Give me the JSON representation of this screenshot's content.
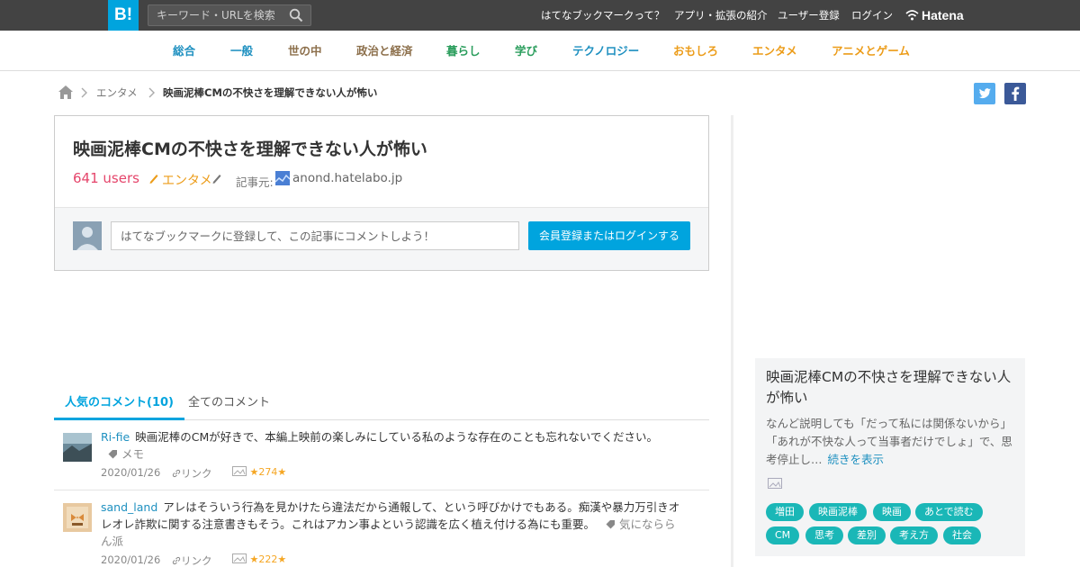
{
  "header": {
    "logo": "B!",
    "search_placeholder": "キーワード・URLを検索",
    "nav": [
      "はてなブックマークって？",
      "アプリ・拡張の紹介",
      "ユーザー登録",
      "ログイン"
    ],
    "brand": "Hatena"
  },
  "categories": [
    {
      "label": "総合",
      "color": "#1e90c0"
    },
    {
      "label": "一般",
      "color": "#1e90c0"
    },
    {
      "label": "世の中",
      "color": "#8c6f4b"
    },
    {
      "label": "政治と経済",
      "color": "#8c6f4b"
    },
    {
      "label": "暮らし",
      "color": "#2a9d5c"
    },
    {
      "label": "学び",
      "color": "#2a9d5c"
    },
    {
      "label": "テクノロジー",
      "color": "#1e90c0"
    },
    {
      "label": "おもしろ",
      "color": "#ec9c19"
    },
    {
      "label": "エンタメ",
      "color": "#ec9c19"
    },
    {
      "label": "アニメとゲーム",
      "color": "#ec9c19"
    }
  ],
  "breadcrumb": {
    "category": "エンタメ",
    "current": "映画泥棒CMの不快さを理解できない人が怖い"
  },
  "article": {
    "title": "映画泥棒CMの不快さを理解できない人が怖い",
    "users": "641 users",
    "category": "エンタメ",
    "source_label": "記事元:",
    "source_domain": "anond.hatelabo.jp",
    "comment_placeholder": "はてなブックマークに登録して、この記事にコメントしよう！",
    "login_button": "会員登録またはログインする"
  },
  "tabs": {
    "popular": "人気のコメント(10)",
    "all": "全てのコメント"
  },
  "comments": [
    {
      "user": "Ri-fie",
      "text": "映画泥棒のCMが好きで、本編上映前の楽しみにしている私のような存在のことも忘れないでください。",
      "tag": "メモ",
      "date": "2020/01/26",
      "link": "リンク",
      "stars": "274"
    },
    {
      "user": "sand_land",
      "text": "アレはそういう行為を見かけたら違法だから通報して、という呼びかけでもある。痴漢や暴力万引きオレオレ詐欺に関する注意書きもそう。これはアカン事よという認識を広く植え付ける為にも重要。",
      "tag": "気になららん派",
      "date": "2020/01/26",
      "link": "リンク",
      "stars": "222"
    }
  ],
  "sidebar": {
    "title": "映画泥棒CMの不快さを理解できない人が怖い",
    "description": "なんど説明しても「だって私には関係ないから」「あれが不快な人って当事者だけでしょ」で、思考停止し…",
    "more": "続きを表示",
    "tags": [
      "増田",
      "映画泥棒",
      "映画",
      "あとで読む",
      "CM",
      "思考",
      "差別",
      "考え方",
      "社会"
    ]
  },
  "colors": {
    "brand_blue": "#00a4de",
    "users_red": "#e5456b",
    "tag_teal": "#1ab7b7",
    "topbar": "#434343"
  }
}
